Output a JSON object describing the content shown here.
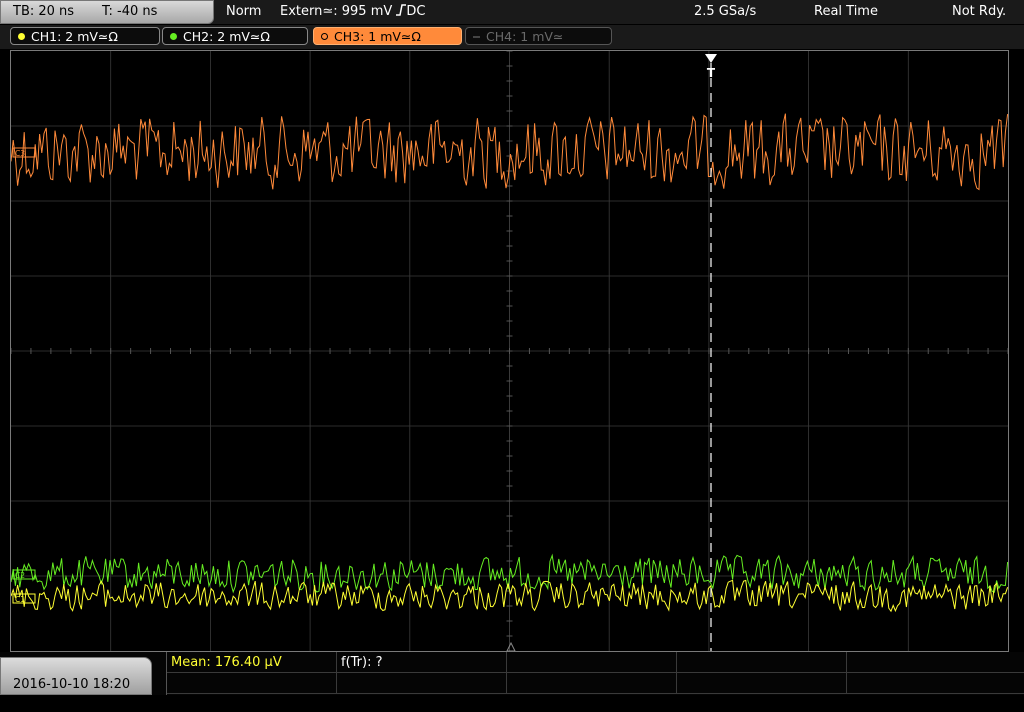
{
  "timebase": {
    "tb": "TB: 20 ns",
    "t": "T: -40 ns"
  },
  "status": {
    "mode": "Norm",
    "trigger": "Extern≃: 995 mV",
    "trigger_edge_coupling": "DC",
    "sample_rate": "2.5 GSa/s",
    "acq_mode": "Real Time",
    "ready": "Not Rdy."
  },
  "channels": [
    {
      "label": "CH1: 2 mV≃Ω",
      "color": "#ffff33",
      "state": "on"
    },
    {
      "label": "CH2: 2 mV≃Ω",
      "color": "#66ee22",
      "state": "on"
    },
    {
      "label": "CH3: 1 mV≃Ω",
      "color": "#ff8a3a",
      "state": "active"
    },
    {
      "label": "CH4: 1 mV≃",
      "color": "#5a5a5a",
      "state": "off"
    }
  ],
  "markers": {
    "trigger": "T",
    "ch3": "C3",
    "ch2": "C2",
    "ch1": "C1"
  },
  "bottom": {
    "datetime": "2016-10-10 18:20",
    "mean_label": "Mean: 176.40 µV",
    "freq_label": "f(Tr): ?"
  },
  "colors": {
    "grid": "#3a3a3a",
    "ch1": "#ffff33",
    "ch2": "#66ee22",
    "ch3": "#ff8a3a",
    "trigger_line": "#ffffff"
  }
}
